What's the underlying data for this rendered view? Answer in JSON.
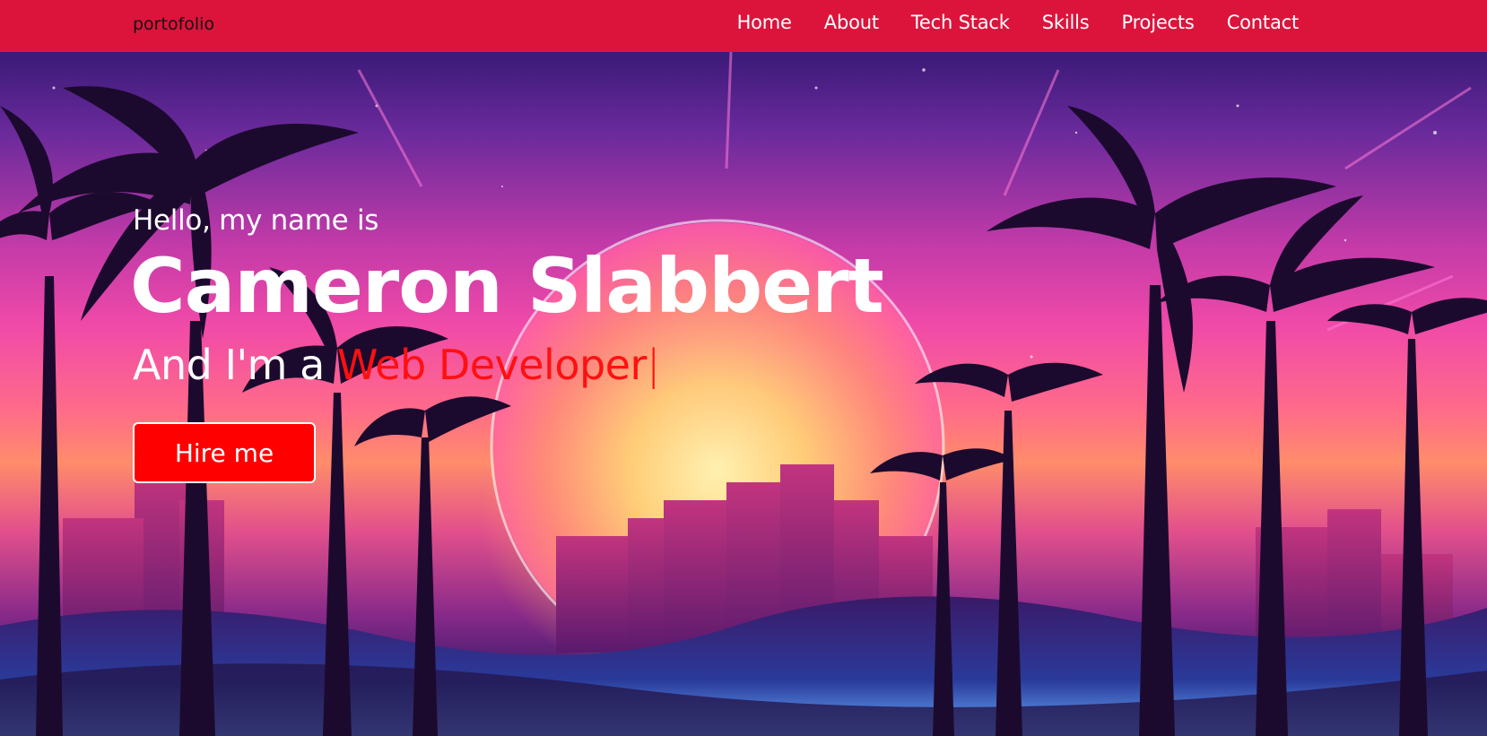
{
  "navbar": {
    "logo": "portofolio",
    "items": [
      {
        "label": "Home"
      },
      {
        "label": "About"
      },
      {
        "label": "Tech Stack"
      },
      {
        "label": "Skills"
      },
      {
        "label": "Projects"
      },
      {
        "label": "Contact"
      }
    ],
    "background_color": "#dc143c"
  },
  "hero": {
    "greeting": "Hello, my name is",
    "name": "Cameron Slabbert",
    "role_prefix": "And I'm a ",
    "role_highlight": "Web Developer",
    "cursor": "|",
    "cta_label": "Hire me",
    "accent_color": "#ff0000",
    "background_scene": "synthwave-sunset-palm-trees"
  }
}
